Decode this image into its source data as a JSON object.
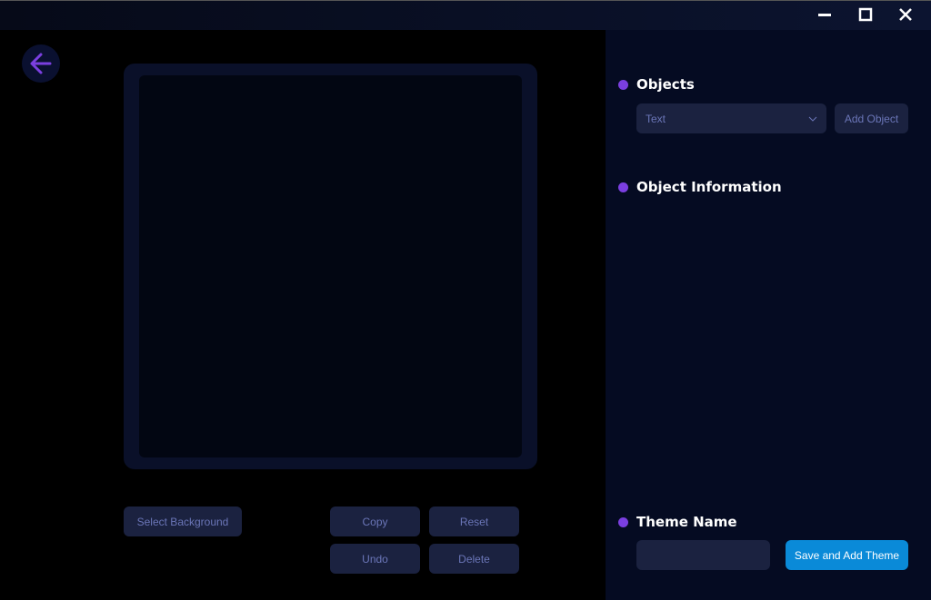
{
  "window": {
    "minimize": "—",
    "maximize": "☐",
    "close": "✕"
  },
  "editor": {
    "buttons": {
      "select_background": "Select Background",
      "copy": "Copy",
      "reset": "Reset",
      "undo": "Undo",
      "delete": "Delete"
    }
  },
  "panel": {
    "objects": {
      "title": "Objects",
      "select_value": "Text",
      "add_button": "Add Object"
    },
    "object_info": {
      "title": "Object Information"
    },
    "theme": {
      "title": "Theme Name",
      "input_value": "",
      "save_button": "Save and Add Theme"
    }
  },
  "colors": {
    "accent": "#7b3fe0",
    "primary": "#0a8ad8"
  }
}
